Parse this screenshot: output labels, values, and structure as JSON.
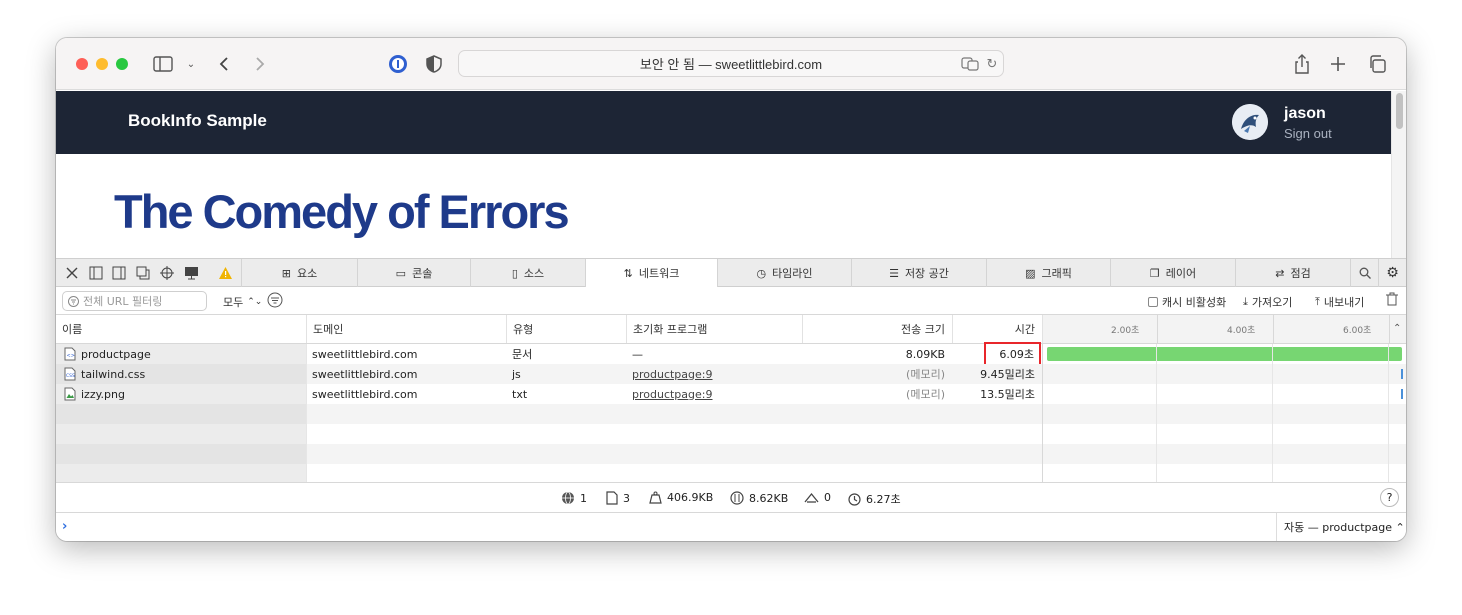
{
  "browser": {
    "address_text": "보안 안 됨 — sweetlittlebird.com"
  },
  "page": {
    "brand": "BookInfo Sample",
    "user_name": "jason",
    "sign_out": "Sign out",
    "heading": "The Comedy of Errors"
  },
  "devtools": {
    "tabs": [
      {
        "label": "요소",
        "icon": "elements-icon"
      },
      {
        "label": "콘솔",
        "icon": "console-icon"
      },
      {
        "label": "소스",
        "icon": "sources-icon"
      },
      {
        "label": "네트워크",
        "icon": "network-icon",
        "active": true
      },
      {
        "label": "타임라인",
        "icon": "timeline-icon"
      },
      {
        "label": "저장 공간",
        "icon": "storage-icon"
      },
      {
        "label": "그래픽",
        "icon": "graphics-icon"
      },
      {
        "label": "레이어",
        "icon": "layers-icon"
      },
      {
        "label": "점검",
        "icon": "audit-icon"
      }
    ],
    "filter": {
      "placeholder": "전체 URL 필터링",
      "type_select": "모두",
      "disable_cache": "캐시 비활성화",
      "import": "가져오기",
      "export": "내보내기"
    },
    "columns": {
      "name": "이름",
      "domain": "도메인",
      "type": "유형",
      "initiator": "초기화 프로그램",
      "transfer_size": "전송 크기",
      "time": "시간"
    },
    "waterfall_ticks": [
      "2.00초",
      "4.00초",
      "6.00초"
    ],
    "rows": [
      {
        "name": "productpage",
        "domain": "sweetlittlebird.com",
        "type": "문서",
        "initiator": "—",
        "size": "8.09KB",
        "time": "6.09초",
        "icon": "document-file-icon",
        "bar_fraction": 1.0
      },
      {
        "name": "tailwind.css",
        "domain": "sweetlittlebird.com",
        "type": "js",
        "initiator": "productpage:9",
        "size": "(메모리)",
        "time": "9.45밀리초",
        "icon": "css-file-icon"
      },
      {
        "name": "izzy.png",
        "domain": "sweetlittlebird.com",
        "type": "txt",
        "initiator": "productpage:9",
        "size": "(메모리)",
        "time": "13.5밀리초",
        "icon": "image-file-icon"
      }
    ],
    "status": {
      "domains": "1",
      "resources": "3",
      "resource_size": "406.9KB",
      "transferred": "8.62KB",
      "redirects": "0",
      "load_time": "6.27초"
    },
    "console_context": "자동 — productpage ⌃"
  },
  "colors": {
    "navbar_bg": "#1d2535",
    "heading": "#1e3a8a",
    "highlight": "#e8262b",
    "waterfall_bar": "#77d672"
  }
}
